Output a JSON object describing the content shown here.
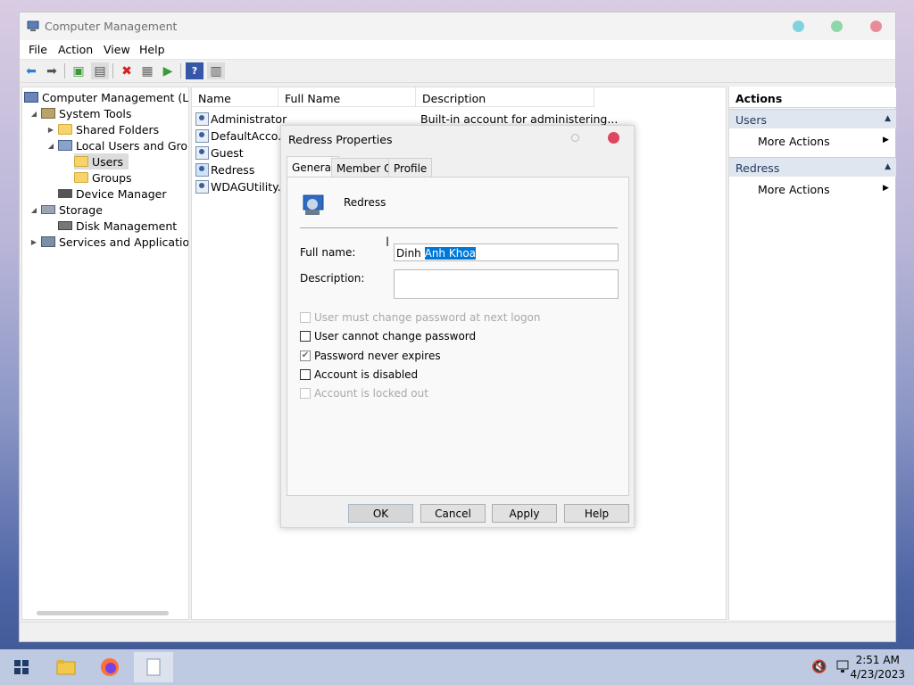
{
  "window": {
    "title": "Computer Management"
  },
  "menu": [
    "File",
    "Action",
    "View",
    "Help"
  ],
  "tree": {
    "root": "Computer Management (Local",
    "system_tools": "System Tools",
    "shared_folders": "Shared Folders",
    "local_users_groups": "Local Users and Groups",
    "users": "Users",
    "groups": "Groups",
    "device_manager": "Device Manager",
    "storage": "Storage",
    "disk_management": "Disk Management",
    "services_apps": "Services and Applications"
  },
  "list": {
    "columns": [
      "Name",
      "Full Name",
      "Description"
    ],
    "rows": [
      {
        "name": "Administrator",
        "full_name": "",
        "description": "Built-in account for administering..."
      },
      {
        "name": "DefaultAcco...",
        "full_name": "",
        "description": ""
      },
      {
        "name": "Guest",
        "full_name": "",
        "description": ""
      },
      {
        "name": "Redress",
        "full_name": "",
        "description": ""
      },
      {
        "name": "WDAGUtility...",
        "full_name": "",
        "description": ""
      }
    ]
  },
  "actions": {
    "header": "Actions",
    "section1": "Users",
    "section1_item": "More Actions",
    "section2": "Redress",
    "section2_item": "More Actions"
  },
  "dialog": {
    "title": "Redress Properties",
    "tabs": [
      "General",
      "Member Of",
      "Profile"
    ],
    "username": "Redress",
    "full_name_label": "Full name:",
    "full_name_unselected": "Dinh ",
    "full_name_selected": "Anh Khoa",
    "description_label": "Description:",
    "description_value": "",
    "checkboxes": [
      {
        "label": "User must change password at next logon",
        "checked": false,
        "disabled": true
      },
      {
        "label": "User cannot change password",
        "checked": false,
        "disabled": false
      },
      {
        "label": "Password never expires",
        "checked": true,
        "disabled": false
      },
      {
        "label": "Account is disabled",
        "checked": false,
        "disabled": false
      },
      {
        "label": "Account is locked out",
        "checked": false,
        "disabled": true
      }
    ],
    "buttons": {
      "ok": "OK",
      "cancel": "Cancel",
      "apply": "Apply",
      "help": "Help"
    }
  },
  "taskbar": {
    "time": "2:51 AM",
    "date": "4/23/2023"
  },
  "colors": {
    "accent": "#0078d7",
    "close": "#e0455f",
    "minimize": "#7fd3dc",
    "maximize": "#8fd6a8"
  }
}
